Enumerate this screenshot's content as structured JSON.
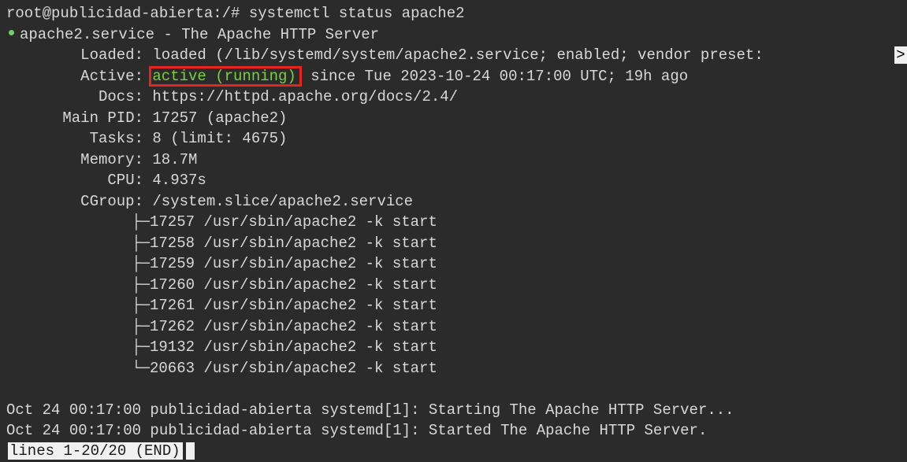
{
  "terminal": {
    "prompt_line": "root@publicidad-abierta:/# systemctl status apache2",
    "unit_line": "apache2.service - The Apache HTTP Server",
    "status_color": "#7ad040",
    "highlight_color": "#e8241c",
    "fields": {
      "loaded": {
        "label": "Loaded:",
        "value": "loaded (/lib/systemd/system/apache2.service; enabled; vendor preset: "
      },
      "active": {
        "label": "Active:",
        "state": "active (running)",
        "rest": " since Tue 2023-10-24 00:17:00 UTC; 19h ago"
      },
      "docs": {
        "label": "Docs:",
        "value": "https://httpd.apache.org/docs/2.4/"
      },
      "main_pid": {
        "label": "Main PID:",
        "value": "17257 (apache2)"
      },
      "tasks": {
        "label": "Tasks:",
        "value": "8 (limit: 4675)"
      },
      "memory": {
        "label": "Memory:",
        "value": "18.7M"
      },
      "cpu": {
        "label": "CPU:",
        "value": "4.937s"
      },
      "cgroup": {
        "label": "CGroup:",
        "value": "/system.slice/apache2.service"
      }
    },
    "truncation_marker": ">",
    "processes": [
      {
        "branch": "├─",
        "entry": "17257 /usr/sbin/apache2 -k start"
      },
      {
        "branch": "├─",
        "entry": "17258 /usr/sbin/apache2 -k start"
      },
      {
        "branch": "├─",
        "entry": "17259 /usr/sbin/apache2 -k start"
      },
      {
        "branch": "├─",
        "entry": "17260 /usr/sbin/apache2 -k start"
      },
      {
        "branch": "├─",
        "entry": "17261 /usr/sbin/apache2 -k start"
      },
      {
        "branch": "├─",
        "entry": "17262 /usr/sbin/apache2 -k start"
      },
      {
        "branch": "├─",
        "entry": "19132 /usr/sbin/apache2 -k start"
      },
      {
        "branch": "└─",
        "entry": "20663 /usr/sbin/apache2 -k start"
      }
    ],
    "log_lines": [
      "Oct 24 00:17:00 publicidad-abierta systemd[1]: Starting The Apache HTTP Server...",
      "Oct 24 00:17:00 publicidad-abierta systemd[1]: Started The Apache HTTP Server."
    ],
    "pager_status": "lines 1-20/20 (END)"
  }
}
